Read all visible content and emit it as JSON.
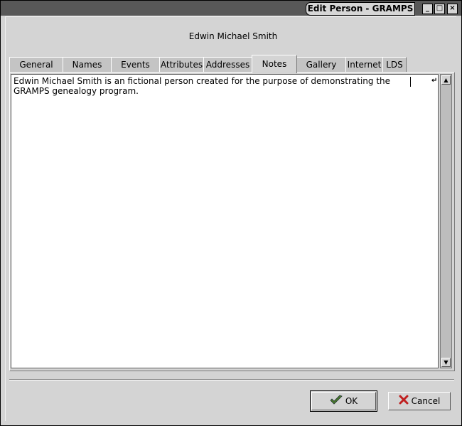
{
  "window": {
    "title": "Edit Person - GRAMPS"
  },
  "person": {
    "name": "Edwin Michael Smith"
  },
  "tabs": [
    {
      "label": "General"
    },
    {
      "label": "Names"
    },
    {
      "label": "Events"
    },
    {
      "label": "Attributes"
    },
    {
      "label": "Addresses"
    },
    {
      "label": "Notes",
      "active": true
    },
    {
      "label": "Gallery"
    },
    {
      "label": "Internet"
    },
    {
      "label": "LDS"
    }
  ],
  "notes": {
    "text": "Edwin Michael Smith is an fictional person created for the purpose of demonstrating the GRAMPS genealogy program."
  },
  "buttons": {
    "ok": "OK",
    "cancel": "Cancel"
  },
  "colors": {
    "titlebar": "#585858",
    "ok_icon": "#4a7a2a",
    "cancel_icon": "#c02020"
  }
}
